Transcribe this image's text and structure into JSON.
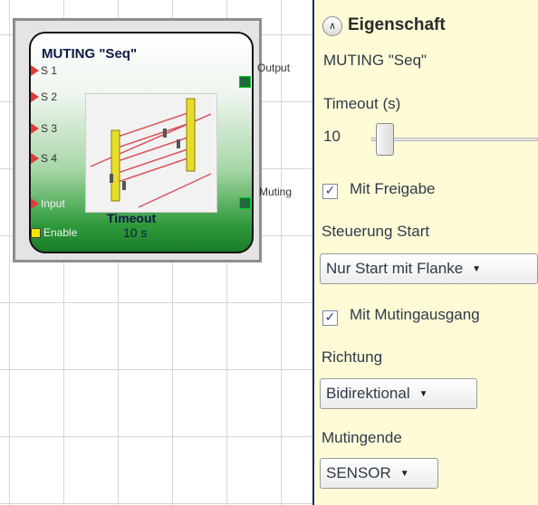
{
  "block": {
    "title": "MUTING \"Seq\"",
    "inputs": [
      "S 1",
      "S 2",
      "S 3",
      "S 4",
      "Input"
    ],
    "enable_label": "Enable",
    "timeout_label": "Timeout",
    "timeout_value": "10 s",
    "outputs": {
      "output": "Output",
      "muting": "Muting"
    }
  },
  "panel": {
    "header": "Eigenschaft",
    "name": "MUTING \"Seq\"",
    "timeout_label": "Timeout (s)",
    "timeout_value": "10",
    "mit_freigabe_label": "Mit Freigabe",
    "mit_freigabe_checked": true,
    "steuerung_label": "Steuerung Start",
    "steuerung_value": "Nur Start mit Flanke",
    "mit_mutingausgang_label": "Mit Mutingausgang",
    "mit_mutingausgang_checked": true,
    "richtung_label": "Richtung",
    "richtung_value": "Bidirektional",
    "mutingende_label": "Mutingende",
    "mutingende_value": "SENSOR"
  },
  "icons": {
    "collapse": "chevron-up-icon",
    "dropdown": "dropdown-arrow-icon",
    "check": "check-icon"
  },
  "colors": {
    "panel_bg": "#fefbd6",
    "block_gradient_end": "#1b7d2a",
    "input_pin": "#e03a3a",
    "enable_pin": "#f3e600",
    "divider": "#1e2a6e"
  }
}
